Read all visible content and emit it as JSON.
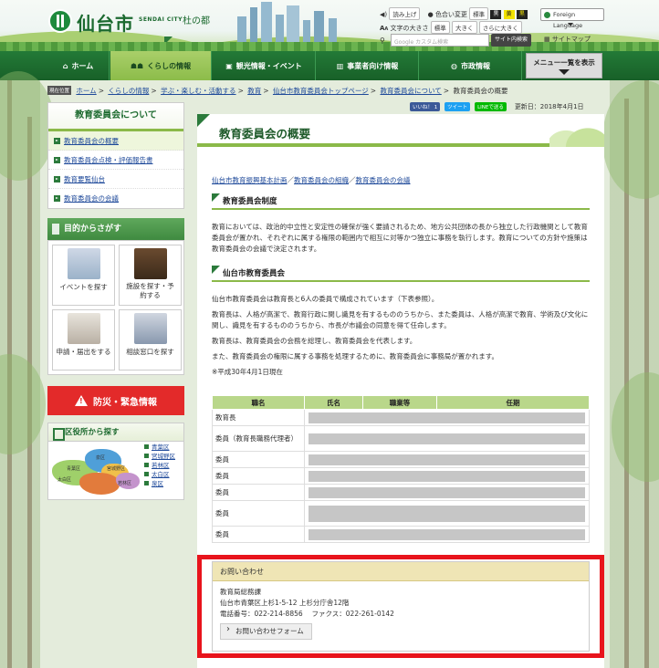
{
  "header": {
    "city_name": "仙台市",
    "city_name_en": "SENDAI CITY",
    "tagline": "杜の都",
    "read_aloud": "読み上げ",
    "color_change": "色合い変更",
    "color_standard": "標準",
    "color_opt1": "黒",
    "color_opt2": "黄",
    "color_opt3": "黒",
    "text_size_label": "文字の大きさ",
    "size_standard": "標準",
    "size_larger": "大きく",
    "size_largest": "さらに大きく",
    "foreign_language": "Foreign Language",
    "search_placeholder": "Google カスタム検索",
    "search_button": "サイト内検索",
    "sitemap": "サイトマップ"
  },
  "nav": {
    "home": "ホーム",
    "kurashi": "くらしの情報",
    "kanko": "観光情報・イベント",
    "jigyosha": "事業者向け情報",
    "shisei": "市政情報",
    "menu": "メニュー一覧を表示"
  },
  "breadcrumb": {
    "here": "現在位置",
    "items": [
      "ホーム",
      "くらしの情報",
      "学ぶ・楽しむ・活動する",
      "教育",
      "仙台市教育委員会トップページ",
      "教育委員会について"
    ],
    "current": "教育委員会の概要"
  },
  "sidebar": {
    "title": "教育委員会について",
    "links": [
      "教育委員会の概要",
      "教育委員会点検・評価報告書",
      "教育要覧仙台",
      "教育委員会の会議"
    ],
    "purpose_title": "目的からさがす",
    "tiles": [
      "イベントを探す",
      "施設を探す・予約する",
      "申請・届出をする",
      "相談窓口を探す"
    ],
    "bousai": "防災・緊急情報",
    "ward_title": "区役所から探す",
    "wards": [
      "青葉区",
      "宮城野区",
      "若林区",
      "太白区",
      "泉区"
    ],
    "map_labels": [
      "青葉区",
      "泉区",
      "宮城野区",
      "若林区",
      "太白区"
    ]
  },
  "share": {
    "facebook": "いいね！ 1",
    "twitter": "ツイート",
    "line": "LINEで送る",
    "updated": "更新日：2018年4月1日"
  },
  "main": {
    "title": "教育委員会の概要",
    "rel_links": [
      "仙台市教育振興基本計画",
      "教育委員会の組織",
      "教育委員会の会議"
    ],
    "sec1_heading": "教育委員会制度",
    "sec1_text": "教育においては、政治的中立性と安定性の確保が強く要請されるため、地方公共団体の長から独立した行政機関として教育委員会が置かれ、それぞれに属する権限の範囲内で相互に対等かつ独立に事務を執行します。教育についての方針や施策は教育委員会の会議で決定されます。",
    "sec2_heading": "仙台市教育委員会",
    "sec2_p1": "仙台市教育委員会は教育長と6人の委員で構成されています（下表参照）。",
    "sec2_p2": "教育長は、人格が高潔で、教育行政に関し識見を有するもののうちから、また委員は、人格が高潔で教育、学術及び文化に関し、識見を有するもののうちから、市長が市議会の同意を得て任命します。",
    "sec2_p3": "教育長は、教育委員会の会務を総理し、教育委員会を代表します。",
    "sec2_p4": "また、教育委員会の権限に属する事務を処理するために、教育委員会に事務局が置かれます。",
    "note": "※平成30年4月1日現在",
    "table": {
      "headers": [
        "職名",
        "氏名",
        "職業等",
        "任期"
      ],
      "rows": [
        "教育長",
        "委員（教育長職務代理者）",
        "委員",
        "委員",
        "委員",
        "委員",
        "委員"
      ]
    },
    "contact": {
      "heading": "お問い合わせ",
      "dept": "教育局総務課",
      "address": "仙台市青葉区上杉1-5-12 上杉分庁舎12階",
      "phone": "電話番号：022-214-8856　 ファクス：022-261-0142",
      "form_button": "お問い合わせフォーム"
    }
  },
  "colors": {
    "brand_green": "#237a37",
    "accent_lime": "#8bb949",
    "alert_red": "#e32a2a",
    "highlight_frame": "#e8141c"
  }
}
